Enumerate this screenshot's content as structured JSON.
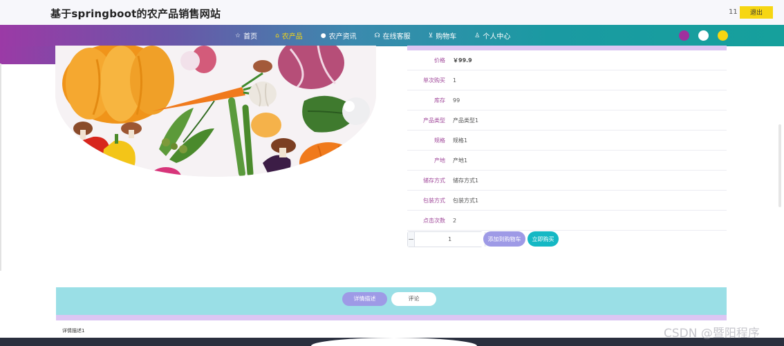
{
  "header": {
    "site_title": "基于springboot的农产品销售网站",
    "user_name": "11",
    "logout_label": "退出"
  },
  "nav": {
    "items": [
      {
        "label": "首页",
        "icon": "home-icon",
        "glyph": "☆"
      },
      {
        "label": "农产品",
        "icon": "bag-icon",
        "glyph": "⌂"
      },
      {
        "label": "农产资讯",
        "icon": "news-icon",
        "glyph": "●"
      },
      {
        "label": "在线客服",
        "icon": "service-icon",
        "glyph": "☊"
      },
      {
        "label": "购物车",
        "icon": "cart-icon",
        "glyph": "⊻"
      },
      {
        "label": "个人中心",
        "icon": "user-icon",
        "glyph": "♙"
      }
    ],
    "active_index": 1,
    "theme_colors": [
      "#a0309e",
      "#ffffff",
      "#f6d612"
    ]
  },
  "product": {
    "fields": [
      {
        "label": "价格",
        "value": "￥99.9"
      },
      {
        "label": "单次购买",
        "value": "1"
      },
      {
        "label": "库存",
        "value": "99"
      },
      {
        "label": "产品类型",
        "value": "产品类型1"
      },
      {
        "label": "规格",
        "value": "规格1"
      },
      {
        "label": "产地",
        "value": "产地1"
      },
      {
        "label": "储存方式",
        "value": "储存方式1"
      },
      {
        "label": "包装方式",
        "value": "包装方式1"
      },
      {
        "label": "点击次数",
        "value": "2"
      }
    ],
    "quantity": "1",
    "minus": "−",
    "plus": "+",
    "add_to_cart_label": "添加到购物车",
    "buy_now_label": "立即购买"
  },
  "tabs": {
    "detail_label": "详情描述",
    "comment_label": "评论"
  },
  "detail_text": "详情描述1",
  "watermark": "CSDN @暨阳程序"
}
